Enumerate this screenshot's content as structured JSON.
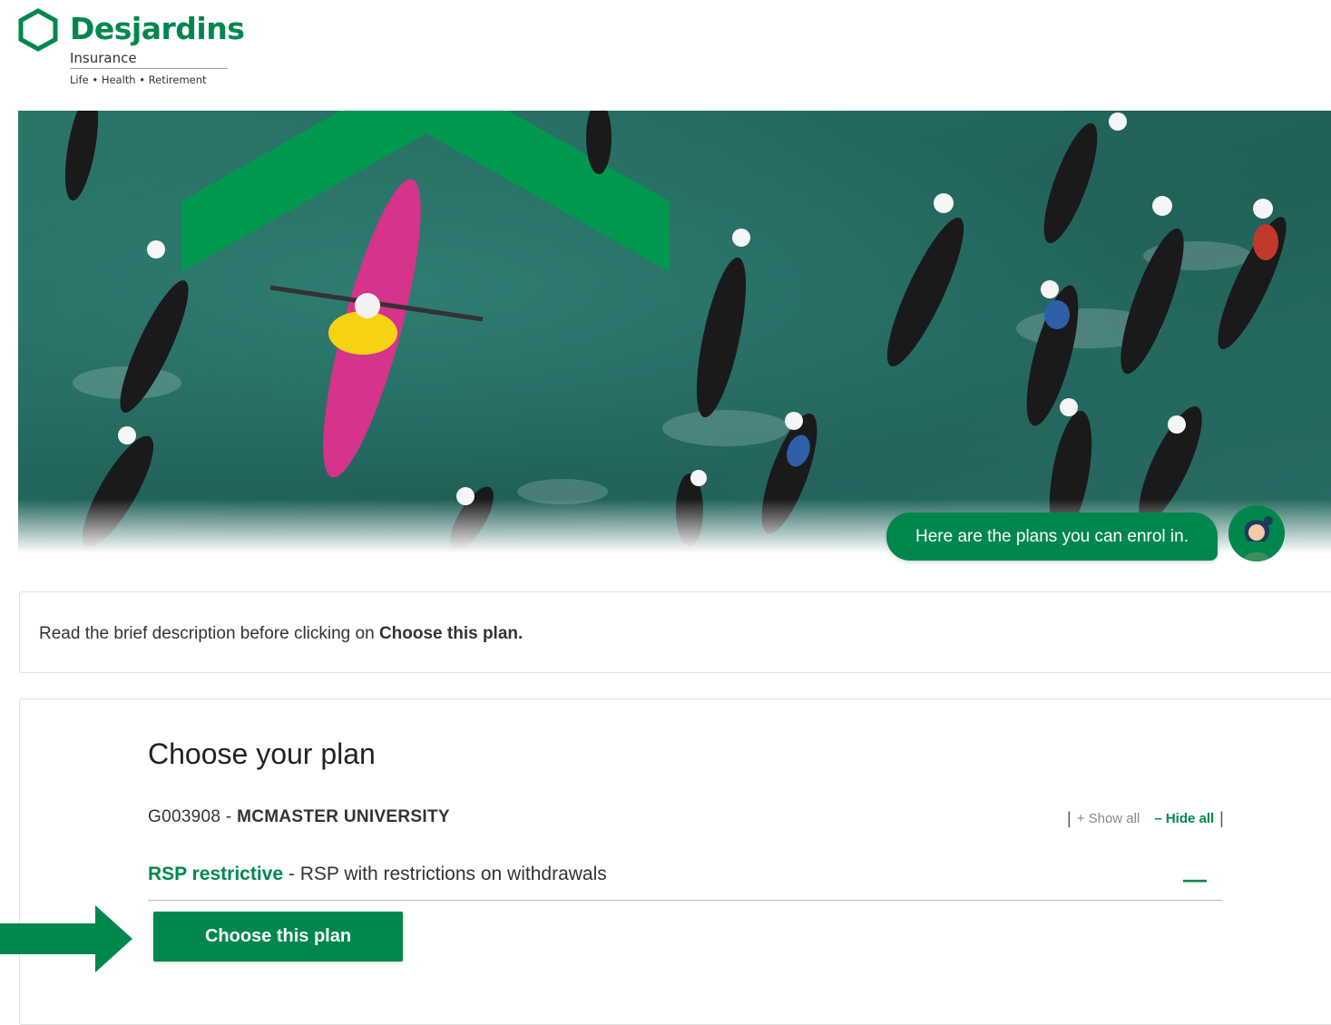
{
  "header": {
    "brand": "Desjardins",
    "subtitle": "Insurance",
    "tagline": "Life • Health • Retirement",
    "logo_icon": "hexagon-logo-icon"
  },
  "hero": {
    "chat_message": "Here are the plans you can enrol in.",
    "avatar_icon": "assistant-avatar-icon"
  },
  "info": {
    "text_prefix": "Read the brief description before clicking on ",
    "text_bold": "Choose this plan."
  },
  "plans": {
    "title": "Choose your plan",
    "group_code": "G003908 - ",
    "group_name": "MCMASTER UNIVERSITY",
    "show_all": "+ Show all",
    "hide_all": "– Hide all",
    "plan_name": "RSP restrictive",
    "plan_desc": " - RSP with restrictions on withdrawals",
    "collapse_symbol": "—",
    "choose_button": "Choose this plan"
  },
  "colors": {
    "brand_green": "#00874e",
    "water": "#2a7468"
  }
}
